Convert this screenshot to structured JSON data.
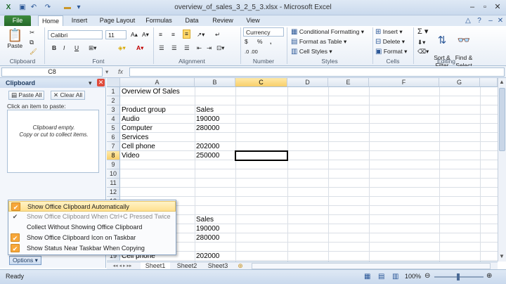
{
  "window": {
    "title": "overview_of_sales_3_2_5_3.xlsx - Microsoft Excel"
  },
  "tabs": [
    "File",
    "Home",
    "Insert",
    "Page Layout",
    "Formulas",
    "Data",
    "Review",
    "View"
  ],
  "ribbon": {
    "groups": [
      "Clipboard",
      "Font",
      "Alignment",
      "Number",
      "Styles",
      "Cells",
      "Editing"
    ],
    "paste": "Paste",
    "font_name": "Calibri",
    "font_size": "11",
    "number_format": "Currency",
    "conditional_formatting": "Conditional Formatting",
    "format_as_table": "Format as Table",
    "cell_styles": "Cell Styles",
    "insert": "Insert",
    "delete": "Delete",
    "format": "Format",
    "sort_filter": "Sort &\nFilter",
    "find_select": "Find &\nSelect",
    "bold": "B",
    "italic": "I",
    "underline": "U",
    "dollar": "$",
    "percent": "%",
    "comma": ",",
    "dec_inc": ".0 .00",
    "sum": "Σ"
  },
  "formula_bar": {
    "name_box": "C8",
    "fx": "fx",
    "formula": ""
  },
  "clipboard_pane": {
    "title": "Clipboard",
    "paste_all": "Paste All",
    "clear_all": "Clear All",
    "hint": "Click an item to paste:",
    "empty_msg_1": "Clipboard empty.",
    "empty_msg_2": "Copy or cut to collect items.",
    "options": "Options"
  },
  "options_menu": [
    {
      "label": "Show Office Clipboard Automatically",
      "checked": true,
      "highlighted": true,
      "disabled": false
    },
    {
      "label": "Show Office Clipboard When Ctrl+C Pressed Twice",
      "checked": true,
      "highlighted": false,
      "disabled": true
    },
    {
      "label": "Collect Without Showing Office Clipboard",
      "checked": false,
      "highlighted": false,
      "disabled": false
    },
    {
      "label": "Show Office Clipboard Icon on Taskbar",
      "checked": true,
      "highlighted": false,
      "disabled": false
    },
    {
      "label": "Show Status Near Taskbar When Copying",
      "checked": true,
      "highlighted": false,
      "disabled": false
    }
  ],
  "columns": [
    "A",
    "B",
    "C",
    "D",
    "E",
    "F",
    "G"
  ],
  "selected_column": "C",
  "selected_row": "8",
  "rows_top": [
    "1",
    "2",
    "3",
    "4",
    "5",
    "6",
    "7",
    "8",
    "9",
    "10",
    "11",
    "12",
    "13"
  ],
  "rows_bottom": [
    "19"
  ],
  "cells": {
    "a1": "Overview Of Sales",
    "a3": "Product group",
    "b3": "Sales",
    "a4": "Audio",
    "b4": "190000",
    "a5": "Computer",
    "b5": "280000",
    "a6": "Services",
    "a7": "Cell phone",
    "b7": "202000",
    "a8": "Video",
    "b8": "250000",
    "b15": "Sales",
    "b16": "190000",
    "b17": "280000",
    "a19": "Cell phone",
    "b19": "202000"
  },
  "sheets": [
    "Sheet1",
    "Sheet2",
    "Sheet3"
  ],
  "status": {
    "ready": "Ready",
    "zoom": "100%"
  }
}
